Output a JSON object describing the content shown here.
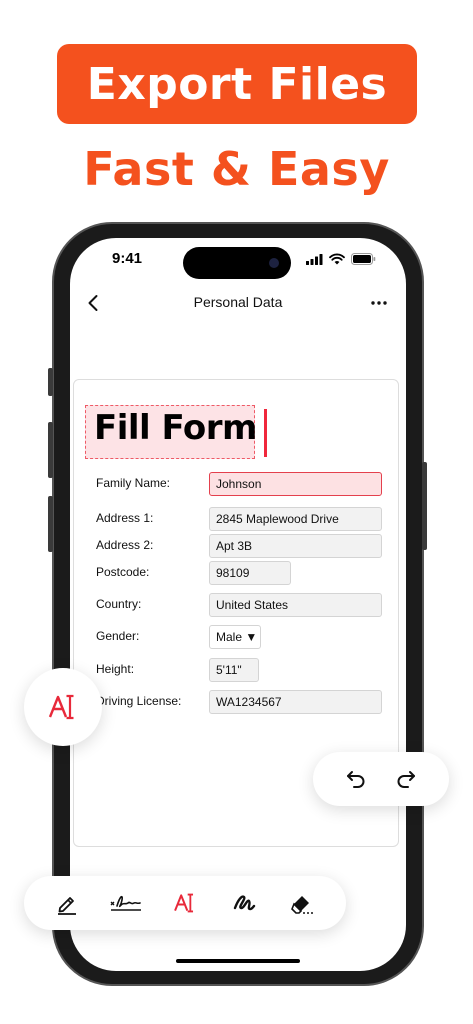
{
  "promo": {
    "headline": "Export Files",
    "subline": "Fast & Easy"
  },
  "colors": {
    "accent": "#f4511e",
    "highlight": "#f0283c"
  },
  "status_bar": {
    "time": "9:41"
  },
  "nav": {
    "title": "Personal Data",
    "back_icon": "chevron-left-icon",
    "more_icon": "more-icon"
  },
  "form": {
    "title": "Fill Form",
    "fields": {
      "family_name": {
        "label": "Family Name:",
        "value": "Johnson"
      },
      "address1": {
        "label": "Address 1:",
        "value": "2845 Maplewood Drive"
      },
      "address2": {
        "label": "Address 2:",
        "value": "Apt 3B"
      },
      "postcode": {
        "label": "Postcode:",
        "value": "98109"
      },
      "country": {
        "label": "Country:",
        "value": "United States"
      },
      "gender": {
        "label": "Gender:",
        "value": "Male ▼"
      },
      "height": {
        "label": "Height:",
        "value": "5'11\""
      },
      "license": {
        "label": "Driving License:",
        "value": "WA1234567"
      }
    }
  },
  "toolbar": {
    "tools": [
      "pen-icon",
      "signature-icon",
      "text-tool-icon",
      "draw-icon",
      "eraser-icon"
    ],
    "active_tool": "text-tool-icon"
  }
}
